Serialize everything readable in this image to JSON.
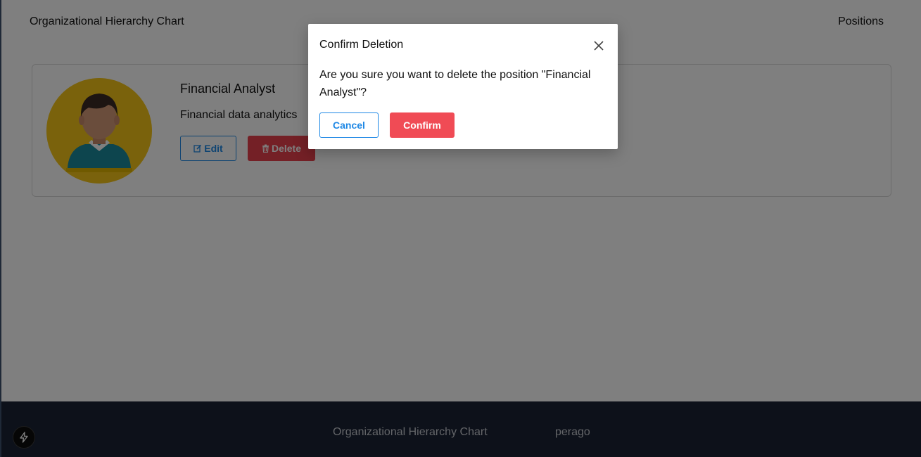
{
  "header": {
    "brand": "Organizational Hierarchy Chart",
    "nav_positions": "Positions"
  },
  "position_card": {
    "title": "Financial Analyst",
    "description": "Financial data analytics",
    "edit_label": "Edit",
    "delete_label": "Delete",
    "edit_icon": "edit-icon",
    "delete_icon": "trash-icon"
  },
  "modal": {
    "title": "Confirm Deletion",
    "message": "Are you sure you want to delete the position \"Financial Analyst\"?",
    "cancel_label": "Cancel",
    "confirm_label": "Confirm",
    "close_icon": "close-icon"
  },
  "footer": {
    "brand": "Organizational Hierarchy Chart",
    "company": "perago",
    "badge_icon": "bolt-icon"
  },
  "colors": {
    "primary": "#1e88e5",
    "danger": "#f04b55",
    "footer_bg": "#1b2234",
    "avatar_bg": "#f5c518"
  }
}
